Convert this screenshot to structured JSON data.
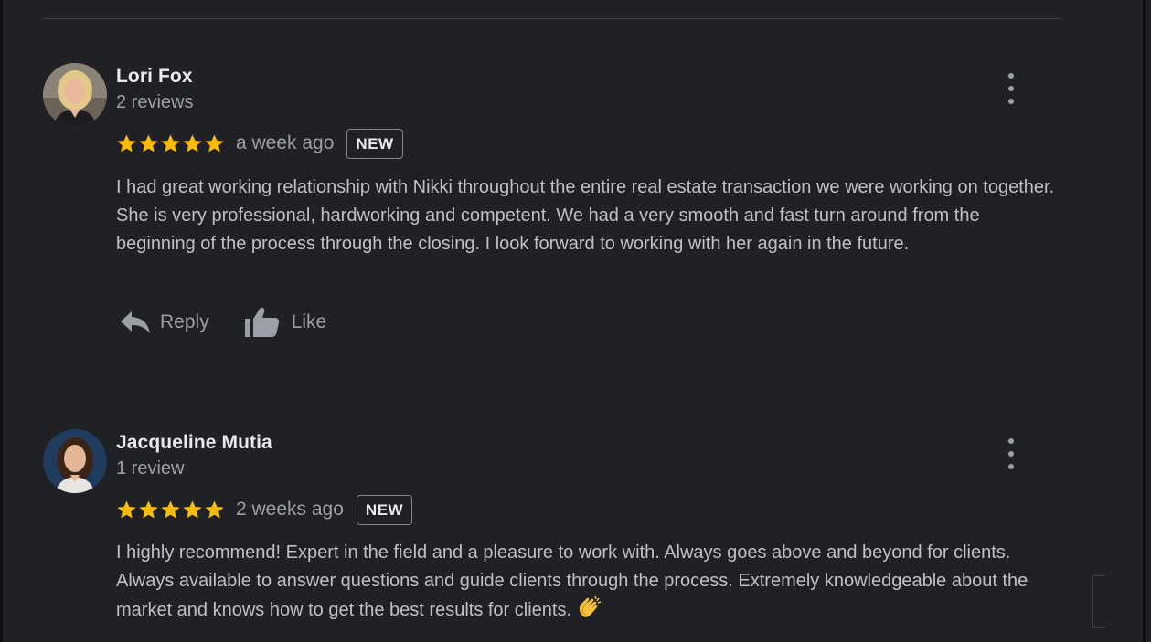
{
  "colors": {
    "background": "#202124",
    "star": "#fbbc04",
    "name_text": "#e8eaed",
    "secondary_text": "#9aa0a6",
    "body_text": "#bdc1c6",
    "divider": "#3c4043"
  },
  "reviews": [
    {
      "name": "Lori Fox",
      "meta": "2 reviews",
      "rating": 5,
      "time": "a week ago",
      "badge": "NEW",
      "text": "I had great working relationship with Nikki throughout the entire real estate transaction we were working on together.  She is very professional, hardworking and competent.  We had a very smooth and fast turn around from the beginning of the process through the closing. I look forward to working with her again in the future.",
      "reply_label": "Reply",
      "like_label": "Like",
      "avatar_icon": "avatar-photo-icon",
      "more_icon": "more-vertical-icon"
    },
    {
      "name": "Jacqueline Mutia",
      "meta": "1 review",
      "rating": 5,
      "time": "2 weeks ago",
      "badge": "NEW",
      "text": "I highly recommend! Expert in the field and a pleasure to work with. Always goes above and beyond for clients. Always available to answer questions and guide clients through the process. Extremely knowledgeable about the market and knows how to get the best results for clients.",
      "emoji_icon": "clapping-hands-icon",
      "avatar_icon": "avatar-photo-icon",
      "more_icon": "more-vertical-icon"
    }
  ]
}
